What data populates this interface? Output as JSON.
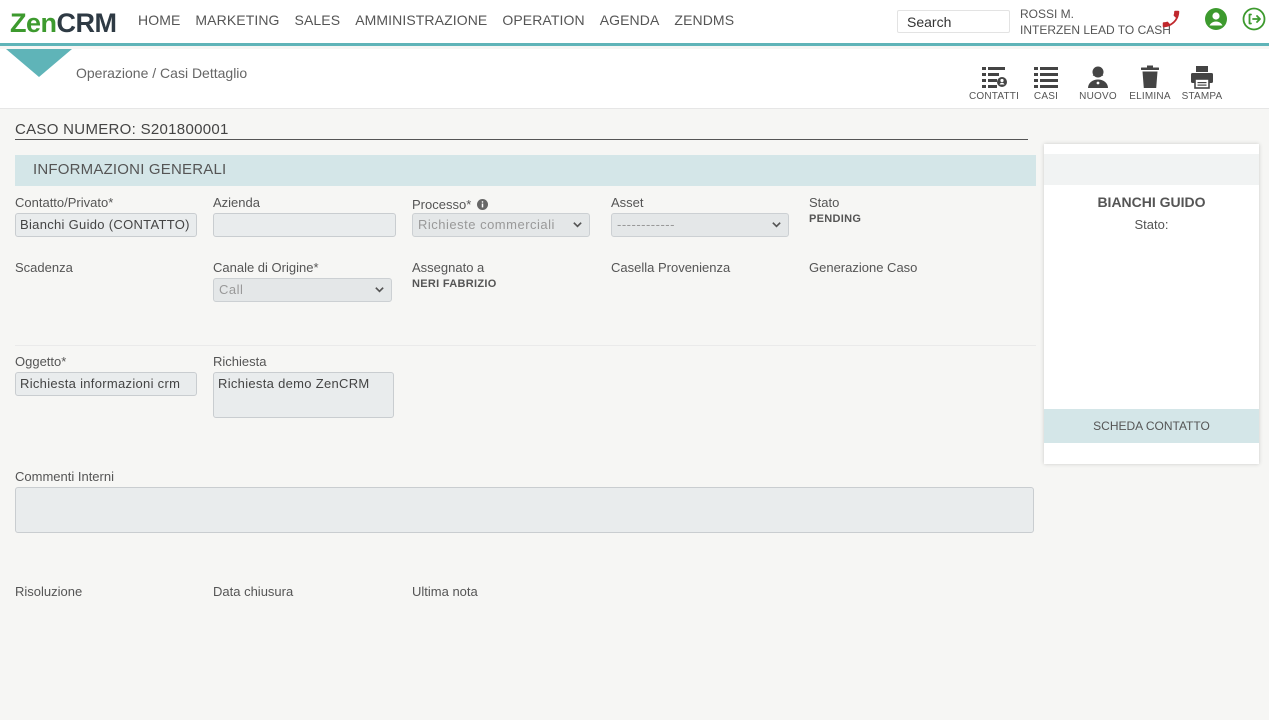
{
  "logo": {
    "zen": "Zen",
    "crm": "CRM"
  },
  "nav": [
    "HOME",
    "MARKETING",
    "SALES",
    "AMMINISTRAZIONE",
    "OPERATION",
    "AGENDA",
    "ZENDMS"
  ],
  "search": {
    "placeholder": "Search"
  },
  "user": {
    "name": "ROSSI M.",
    "company": "INTERZEN LEAD TO CASH"
  },
  "colors": {
    "brand_green": "#3d9a2e",
    "accent_teal": "#5fb4b8",
    "phone_red": "#c0282d"
  },
  "icons": {
    "phone": "phone-icon",
    "user": "user-circle-icon",
    "logout": "logout-icon"
  },
  "breadcrumb": "Operazione / Casi Dettaglio",
  "toolbar": {
    "contatti": "CONTATTI",
    "casi": "CASI",
    "nuovo": "NUOVO",
    "elimina": "ELIMINA",
    "stampa": "STAMPA"
  },
  "case": {
    "title": "CASO NUMERO: S201800001"
  },
  "section": {
    "title": "INFORMAZIONI GENERALI"
  },
  "form": {
    "contatto_label": "Contatto/Privato*",
    "contatto_value": "Bianchi Guido (CONTATTO)",
    "azienda_label": "Azienda",
    "azienda_value": "",
    "processo_label": "Processo*",
    "processo_value": "Richieste commerciali",
    "asset_label": "Asset",
    "asset_value": "------------",
    "stato_label": "Stato",
    "stato_value": "PENDING",
    "scadenza_label": "Scadenza",
    "canale_label": "Canale di Origine*",
    "canale_value": "Call",
    "assegnato_label": "Assegnato a",
    "assegnato_value": "NERI FABRIZIO",
    "casella_label": "Casella Provenienza",
    "generazione_label": "Generazione Caso",
    "oggetto_label": "Oggetto*",
    "oggetto_value": "Richiesta informazioni crm",
    "richiesta_label": "Richiesta",
    "richiesta_value": "Richiesta demo ZenCRM",
    "commenti_label": "Commenti Interni",
    "commenti_value": "",
    "risoluzione_label": "Risoluzione",
    "chiusura_label": "Data chiusura",
    "nota_label": "Ultima nota"
  },
  "card": {
    "name": "BIANCHI GUIDO",
    "stato": "Stato:",
    "button": "SCHEDA CONTATTO"
  }
}
